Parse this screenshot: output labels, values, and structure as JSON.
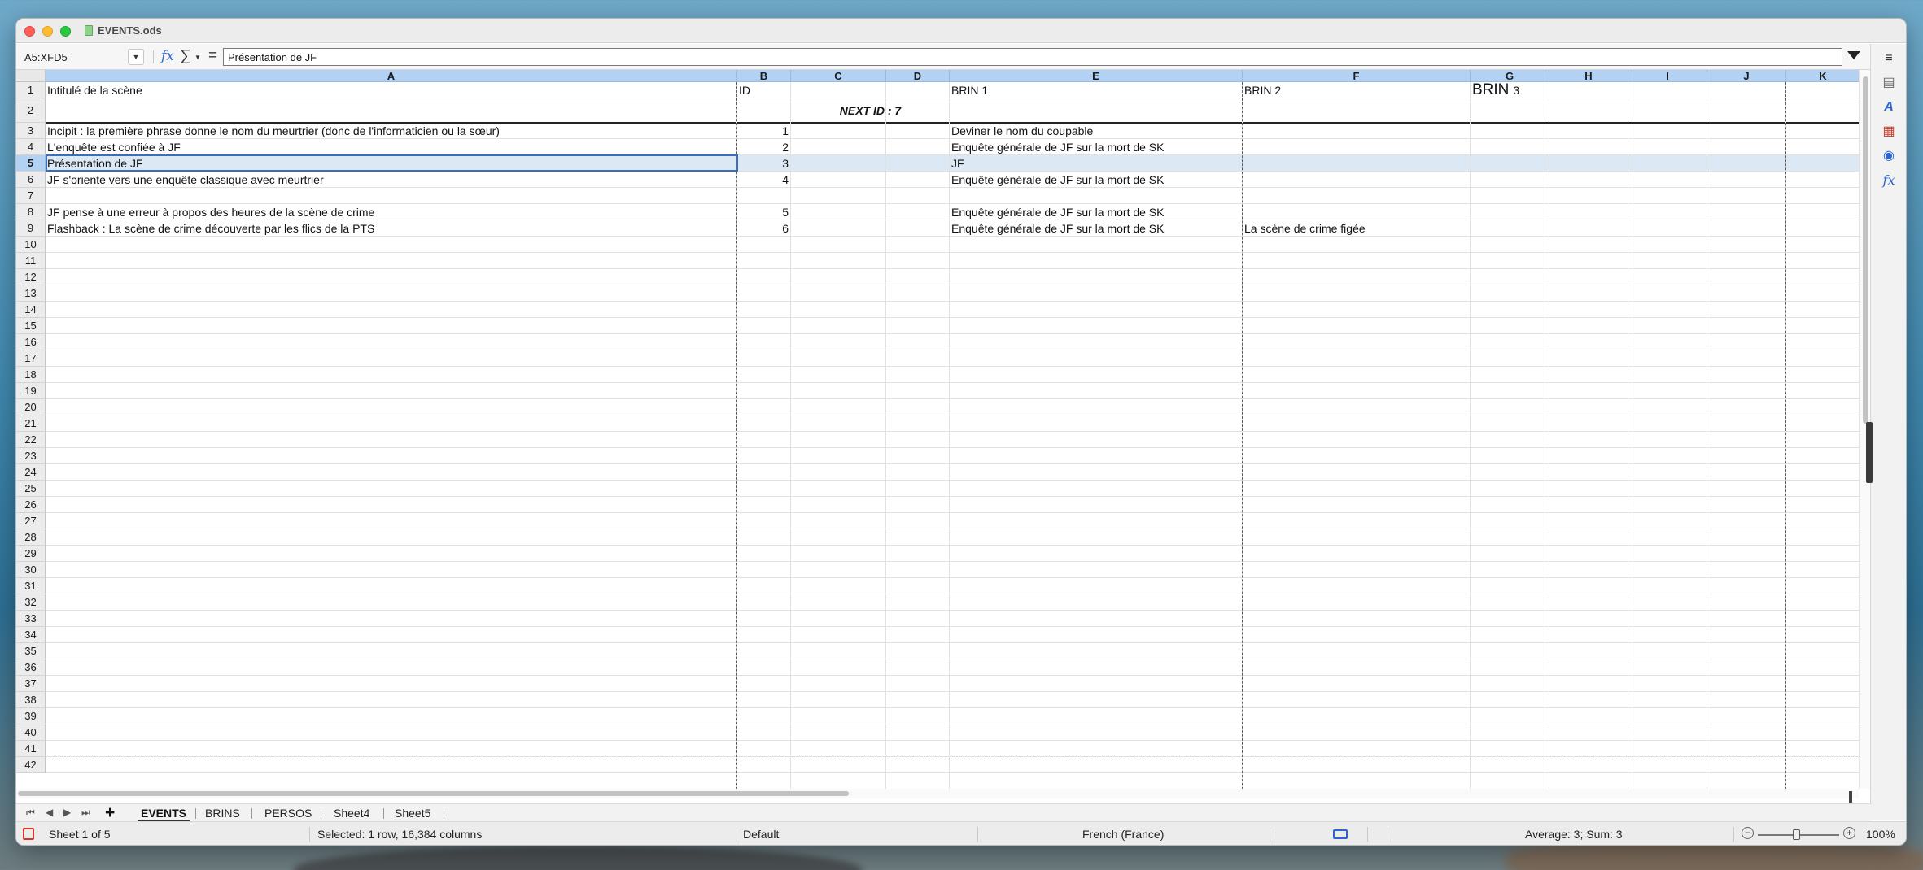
{
  "window": {
    "title": "EVENTS.ods"
  },
  "formula_bar": {
    "name_box": "A5:XFD5",
    "formula": "Présentation de JF"
  },
  "columns": [
    "A",
    "B",
    "C",
    "D",
    "E",
    "F",
    "G",
    "H",
    "I",
    "J",
    "K"
  ],
  "rows": [
    "1",
    "2",
    "3",
    "4",
    "5",
    "6",
    "7",
    "8",
    "9",
    "10",
    "11",
    "12",
    "13",
    "14",
    "15",
    "16",
    "17",
    "18",
    "19",
    "20",
    "21",
    "22",
    "23",
    "24",
    "25",
    "26",
    "27",
    "28",
    "29",
    "30",
    "31",
    "32",
    "33",
    "34",
    "35",
    "36",
    "37",
    "38",
    "39",
    "40",
    "41",
    "42"
  ],
  "selected_row": "5",
  "cells": {
    "r1": {
      "A": "Intitulé de la scène",
      "B": "ID",
      "E": "BRIN 1",
      "F": "BRIN 2",
      "G": "BRIN",
      "G_sub": "3"
    },
    "r2": {
      "C": "NEXT ID :  7"
    },
    "r3": {
      "A": "Incipit : la première phrase donne le nom du meurtrier (donc de l'informaticien ou la sœur)",
      "B": "1",
      "E": "Deviner le nom du coupable"
    },
    "r4": {
      "A": "L'enquête est confiée à JF",
      "B": "2",
      "E": "Enquête générale de JF sur la mort de SK"
    },
    "r5": {
      "A": "Présentation de JF",
      "B": "3",
      "E": "JF"
    },
    "r6": {
      "A": "JF s'oriente vers une enquête classique avec meurtrier",
      "B": "4",
      "E": "Enquête générale de JF sur la mort de SK"
    },
    "r8": {
      "A": "JF pense à une erreur à propos des heures de la scène de crime",
      "B": "5",
      "E": "Enquête générale de JF sur la mort de SK"
    },
    "r9": {
      "A": "Flashback : La scène de crime découverte par les flics de la PTS",
      "B": "6",
      "E": "Enquête générale de JF sur la mort de SK",
      "F": "La scène de crime figée"
    }
  },
  "sheet_tabs": [
    "EVENTS",
    "BRINS",
    "PERSOS",
    "Sheet4",
    "Sheet5"
  ],
  "active_tab": "EVENTS",
  "status": {
    "sheet": "Sheet 1 of 5",
    "selection": "Selected: 1 row, 16,384 columns",
    "page_style": "Default",
    "language": "French (France)",
    "stats": "Average: 3; Sum: 3",
    "zoom": "100%"
  },
  "colors": {
    "header_selected": "#b3d2f3",
    "cursor": "#3b6eb8",
    "row_band": "#dde8f5"
  }
}
